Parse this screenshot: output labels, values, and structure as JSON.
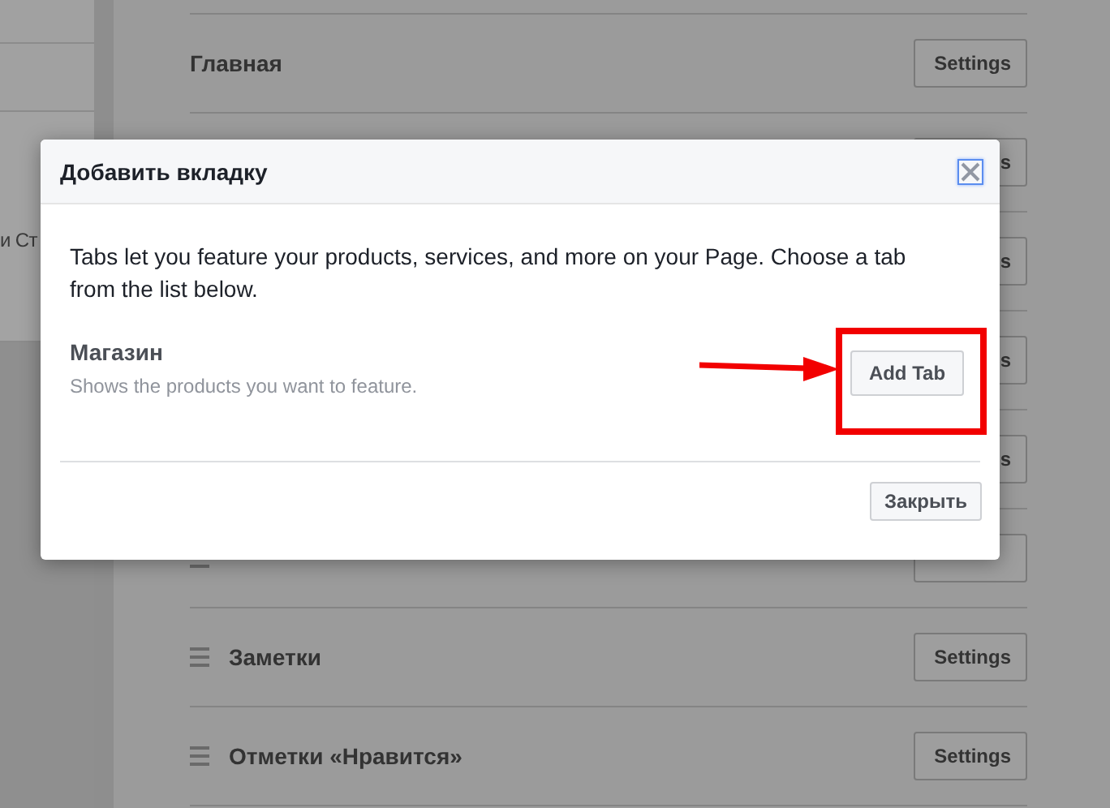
{
  "sidebar": {
    "items": [
      "и Ст"
    ]
  },
  "tabs": [
    {
      "name": "Главная",
      "handle": false,
      "button": "Settings"
    },
    {
      "button": "s",
      "handle": false
    },
    {
      "button": "s",
      "handle": false
    },
    {
      "button": "s",
      "handle": false
    },
    {
      "button": "s",
      "handle": false
    },
    {
      "handle": true
    },
    {
      "name": "Заметки",
      "handle": true,
      "button": "Settings"
    },
    {
      "name": "Отметки «Нравится»",
      "handle": true,
      "button": "Settings"
    }
  ],
  "dialog": {
    "title": "Добавить вкладку",
    "intro": "Tabs let you feature your products, services, and more on your Page. Choose a tab from the list below.",
    "items": [
      {
        "name": "Магазин",
        "description": "Shows the products you want to feature.",
        "button": "Add Tab",
        "highlighted": true
      }
    ],
    "close_button": "Закрыть"
  }
}
